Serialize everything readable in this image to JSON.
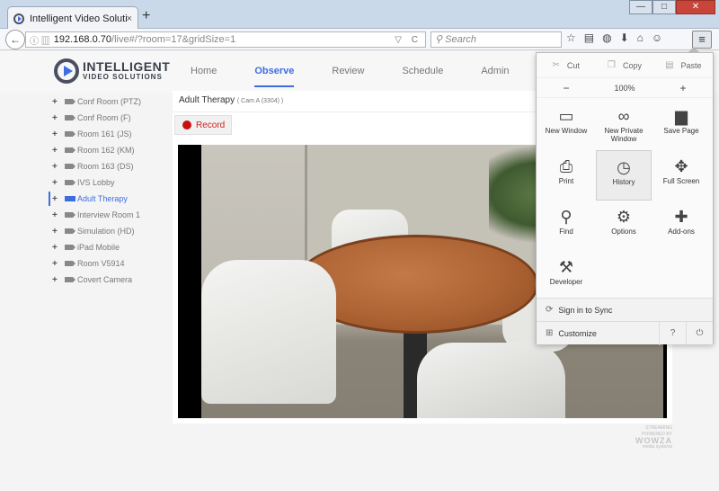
{
  "browser": {
    "tab_title": "Intelligent Video Solutions",
    "tab_close": "×",
    "new_tab": "+",
    "window_controls": {
      "minimize": "—",
      "maximize": "□",
      "close": "✕"
    },
    "url_host": "192.168.0.70",
    "url_path": "/live#/?room=17&gridSize=1",
    "url_right_icons": "▽ C",
    "search_placeholder": "Search",
    "toolbar_icons": [
      "☆",
      "▤",
      "◍",
      "⬇",
      "⌂",
      "☺"
    ],
    "menu_icon": "≡"
  },
  "site": {
    "logo_line1": "INTELLIGENT",
    "logo_line2": "VIDEO SOLUTIONS",
    "nav": [
      {
        "label": "Home",
        "active": false
      },
      {
        "label": "Observe",
        "active": true
      },
      {
        "label": "Review",
        "active": false
      },
      {
        "label": "Schedule",
        "active": false
      },
      {
        "label": "Admin",
        "active": false
      }
    ]
  },
  "sidebar": {
    "items": [
      {
        "label": "Conf Room (PTZ)",
        "active": false
      },
      {
        "label": "Conf Room (F)",
        "active": false
      },
      {
        "label": "Room 161 (JS)",
        "active": false
      },
      {
        "label": "Room 162 (KM)",
        "active": false
      },
      {
        "label": "Room 163 (DS)",
        "active": false
      },
      {
        "label": "IVS Lobby",
        "active": false
      },
      {
        "label": "Adult Therapy",
        "active": true
      },
      {
        "label": "Interview Room 1",
        "active": false
      },
      {
        "label": "Simulation (HD)",
        "active": false
      },
      {
        "label": "iPad Mobile",
        "active": false
      },
      {
        "label": "Room V5914",
        "active": false
      },
      {
        "label": "Covert Camera",
        "active": false
      }
    ]
  },
  "content": {
    "room_title": "Adult Therapy",
    "camera_sub": "( Cam A (3304) )",
    "record_label": "Record"
  },
  "wowza": {
    "line1": "STREAMING POWERED BY",
    "brand": "WOWZA",
    "line2": "media systems"
  },
  "menu": {
    "cut": "Cut",
    "copy": "Copy",
    "paste": "Paste",
    "zoom_out": "−",
    "zoom_level": "100%",
    "zoom_in": "+",
    "tiles": [
      {
        "label": "New Window",
        "icon": "▭",
        "name": "new-window"
      },
      {
        "label": "New Private Window",
        "icon": "∞",
        "name": "new-private-window"
      },
      {
        "label": "Save Page",
        "icon": "▆",
        "name": "save-page"
      },
      {
        "label": "Print",
        "icon": "⎙",
        "name": "print"
      },
      {
        "label": "History",
        "icon": "◷",
        "name": "history"
      },
      {
        "label": "Full Screen",
        "icon": "✥",
        "name": "full-screen"
      },
      {
        "label": "Find",
        "icon": "⚲",
        "name": "find"
      },
      {
        "label": "Options",
        "icon": "⚙",
        "name": "options"
      },
      {
        "label": "Add-ons",
        "icon": "✚",
        "name": "add-ons"
      },
      {
        "label": "Developer",
        "icon": "⚒",
        "name": "developer"
      }
    ],
    "sign_in": "Sign in to Sync",
    "customize": "Customize",
    "help": "?",
    "power": "⏻"
  },
  "colors": {
    "accent": "#3f6de0",
    "record": "#c91010"
  }
}
